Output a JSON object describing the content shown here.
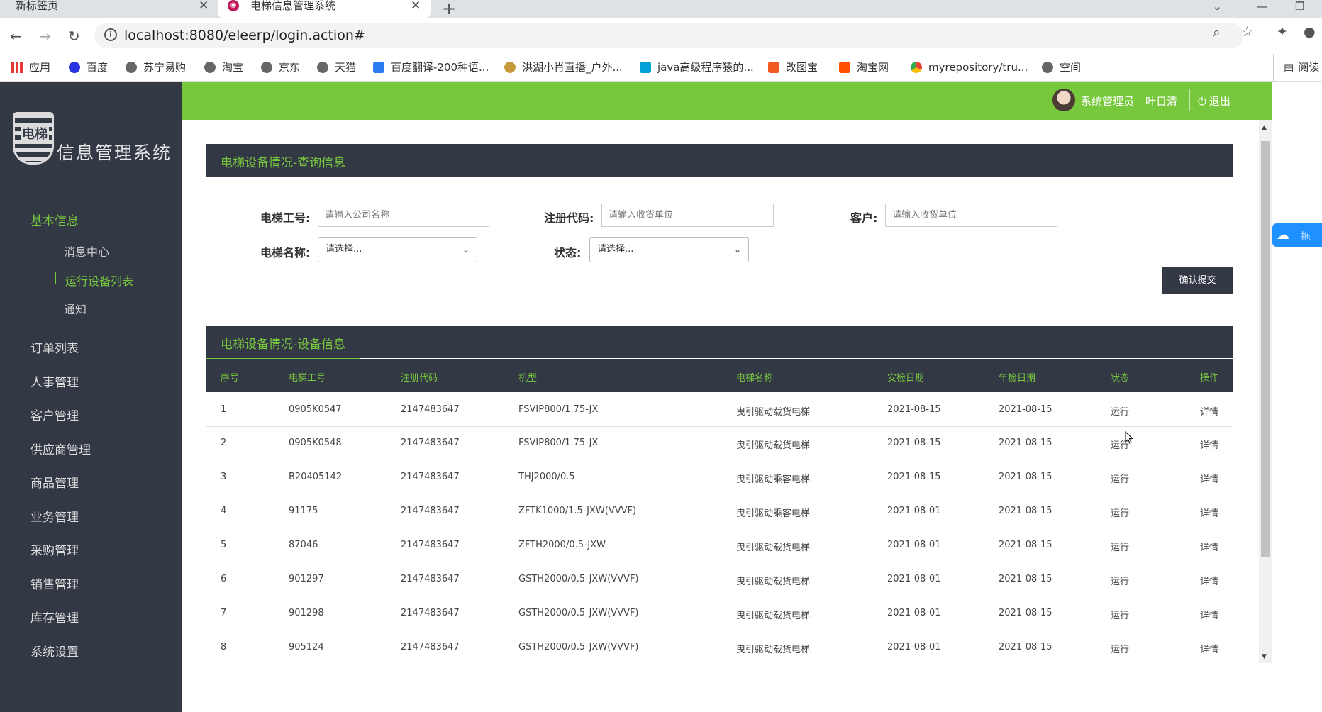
{
  "browser": {
    "tabs": [
      {
        "title": "新标签页"
      },
      {
        "title": "电梯信息管理系统"
      }
    ],
    "url": "localhost:8080/eleerp/login.action#",
    "bookmarks": [
      "应用",
      "百度",
      "苏宁易购",
      "淘宝",
      "京东",
      "天猫",
      "百度翻译-200种语...",
      "洪湖小肖直播_户外...",
      "java高级程序猿的...",
      "改图宝",
      "淘宝网",
      "myrepository/tru...",
      "空间"
    ],
    "reading_mode": "阅读"
  },
  "logo": {
    "badge": "电梯",
    "text": "信息管理系统"
  },
  "sidebar": {
    "menu": [
      {
        "label": "基本信息",
        "active": true
      },
      {
        "label": "订单列表"
      },
      {
        "label": "人事管理"
      },
      {
        "label": "客户管理"
      },
      {
        "label": "供应商管理"
      },
      {
        "label": "商品管理"
      },
      {
        "label": "业务管理"
      },
      {
        "label": "采购管理"
      },
      {
        "label": "销售管理"
      },
      {
        "label": "库存管理"
      },
      {
        "label": "系统设置"
      }
    ],
    "submenu": [
      {
        "label": "消息中心"
      },
      {
        "label": "运行设备列表",
        "active": true
      },
      {
        "label": "通知"
      }
    ]
  },
  "topbar": {
    "role": "系统管理员",
    "user": "叶日清",
    "logout": "退出"
  },
  "query_panel": {
    "title": "电梯设备情况-查询信息",
    "fields": {
      "elevator_no": {
        "label": "电梯工号:",
        "placeholder": "请输入公司名称"
      },
      "reg_code": {
        "label": "注册代码:",
        "placeholder": "请输入收货单位"
      },
      "customer": {
        "label": "客户:",
        "placeholder": "请输入收货单位"
      },
      "elevator_name": {
        "label": "电梯名称:",
        "value": "请选择..."
      },
      "status": {
        "label": "状态:",
        "value": "请选择..."
      }
    },
    "submit": "确认提交"
  },
  "device_panel": {
    "title": "电梯设备情况-设备信息",
    "columns": [
      "序号",
      "电梯工号",
      "注册代码",
      "机型",
      "电梯名称",
      "安检日期",
      "年检日期",
      "状态",
      "操作"
    ],
    "rows": [
      [
        "1",
        "0905K0547",
        "2147483647",
        "FSVIP800/1.75-JX",
        "曳引驱动载货电梯",
        "2021-08-15",
        "2021-08-15",
        "运行",
        "详情"
      ],
      [
        "2",
        "0905K0548",
        "2147483647",
        "FSVIP800/1.75-JX",
        "曳引驱动载货电梯",
        "2021-08-15",
        "2021-08-15",
        "运行",
        "详情"
      ],
      [
        "3",
        "B20405142",
        "2147483647",
        "THJ2000/0.5-",
        "曳引驱动乘客电梯",
        "2021-08-15",
        "2021-08-15",
        "运行",
        "详情"
      ],
      [
        "4",
        "91175",
        "2147483647",
        "ZFTK1000/1.5-JXW(VVVF)",
        "曳引驱动乘客电梯",
        "2021-08-01",
        "2021-08-15",
        "运行",
        "详情"
      ],
      [
        "5",
        "87046",
        "2147483647",
        "ZFTH2000/0.5-JXW",
        "曳引驱动载货电梯",
        "2021-08-01",
        "2021-08-15",
        "运行",
        "详情"
      ],
      [
        "6",
        "901297",
        "2147483647",
        "GSTH2000/0.5-JXW(VVVF)",
        "曳引驱动载货电梯",
        "2021-08-01",
        "2021-08-15",
        "运行",
        "详情"
      ],
      [
        "7",
        "901298",
        "2147483647",
        "GSTH2000/0.5-JXW(VVVF)",
        "曳引驱动载货电梯",
        "2021-08-01",
        "2021-08-15",
        "运行",
        "详情"
      ],
      [
        "8",
        "905124",
        "2147483647",
        "GSTH2000/0.5-JXW(VVVF)",
        "曳引驱动载货电梯",
        "2021-08-01",
        "2021-08-15",
        "运行",
        "详情"
      ]
    ]
  },
  "float_badge": {
    "text": "拖"
  },
  "colors": {
    "accent": "#78c83e",
    "dark": "#333845"
  }
}
